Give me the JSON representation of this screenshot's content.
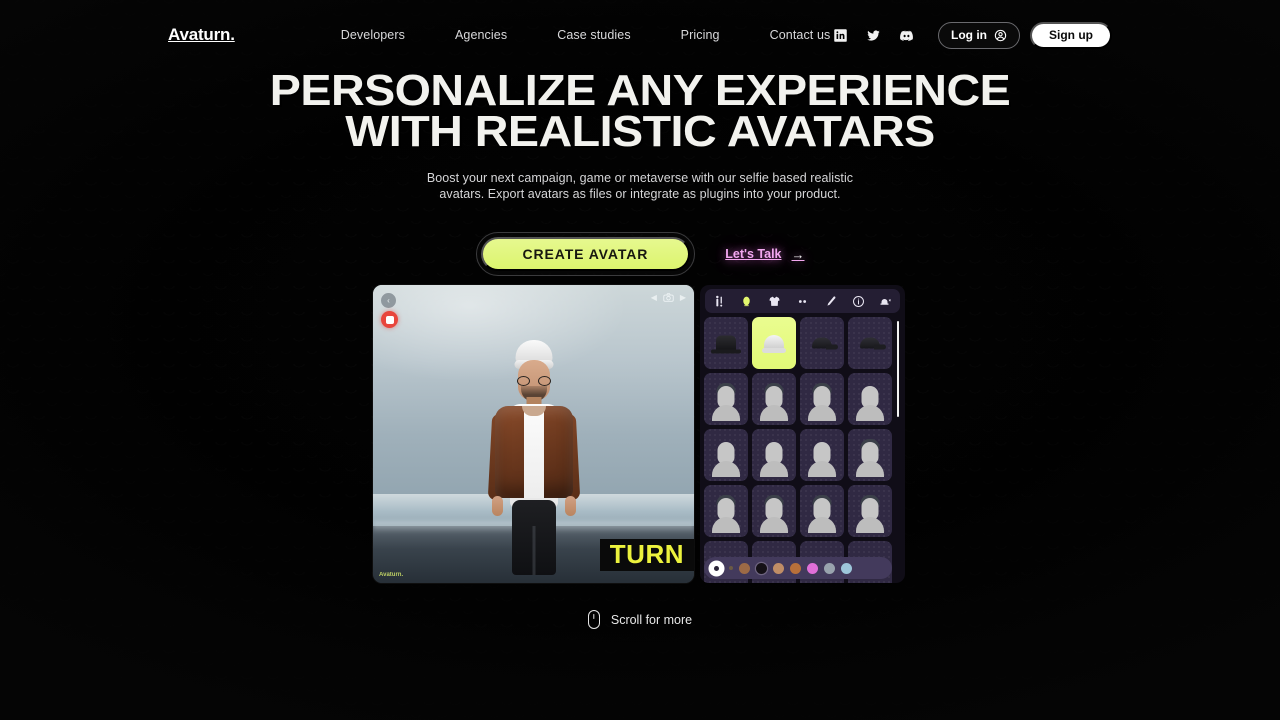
{
  "brand": {
    "name": "Avaturn."
  },
  "nav": {
    "links": [
      {
        "label": "Developers"
      },
      {
        "label": "Agencies"
      },
      {
        "label": "Case studies"
      },
      {
        "label": "Pricing"
      },
      {
        "label": "Contact us"
      }
    ],
    "social": [
      {
        "name": "linkedin-icon"
      },
      {
        "name": "twitter-icon"
      },
      {
        "name": "discord-icon"
      }
    ],
    "login_label": "Log in",
    "signup_label": "Sign up"
  },
  "hero": {
    "headline_line1": "PERSONALIZE ANY EXPERIENCE",
    "headline_line2": "WITH REALISTIC AVATARS",
    "subtitle_line1": "Boost your next campaign, game or metaverse with our selfie based realistic",
    "subtitle_line2": "avatars. Export avatars as files or integrate as plugins into your product.",
    "cta_primary": "CREATE AVATAR",
    "cta_secondary": "Let's Talk",
    "cta_secondary_arrow": "→"
  },
  "app": {
    "viewport": {
      "watermark": "Avaturn.",
      "turn_badge": "TURN",
      "back_glyph": "‹",
      "camera_prev_glyph": "◀",
      "camera_next_glyph": "▶"
    },
    "editor": {
      "toolbar": [
        {
          "name": "body-icon",
          "active": false
        },
        {
          "name": "head-icon",
          "active": true
        },
        {
          "name": "shirt-icon",
          "active": false
        },
        {
          "name": "eyes-icon",
          "active": false
        },
        {
          "name": "brush-icon",
          "active": false
        },
        {
          "name": "info-icon",
          "active": false
        },
        {
          "name": "remove-hat-icon",
          "active": false
        }
      ],
      "grid_items": [
        {
          "type": "hat-top",
          "selected": false
        },
        {
          "type": "hat-beanie",
          "selected": true
        },
        {
          "type": "hat-cap",
          "selected": false
        },
        {
          "type": "hat-cap",
          "selected": false
        },
        {
          "type": "hair-short",
          "selected": false
        },
        {
          "type": "hair-short",
          "selected": false
        },
        {
          "type": "hair-short",
          "selected": false
        },
        {
          "type": "hair-bald",
          "selected": false
        },
        {
          "type": "hair-bald",
          "selected": false
        },
        {
          "type": "hair-bald",
          "selected": false
        },
        {
          "type": "hair-bald",
          "selected": false
        },
        {
          "type": "hair-side",
          "selected": false
        },
        {
          "type": "hair-curly",
          "selected": false
        },
        {
          "type": "hair-short",
          "selected": false
        },
        {
          "type": "hair-long",
          "selected": false
        },
        {
          "type": "hair-short",
          "selected": false
        }
      ],
      "colors": [
        {
          "hex": "#ffffff",
          "selected": true
        },
        {
          "hex": "#6b5a44",
          "tiny": true
        },
        {
          "hex": "#9c6a46"
        },
        {
          "hex": "#141016"
        },
        {
          "hex": "#c08d66"
        },
        {
          "hex": "#b8703a"
        },
        {
          "hex": "#e06fd8"
        },
        {
          "hex": "#99a3ae"
        },
        {
          "hex": "#9dc6da"
        }
      ]
    }
  },
  "footer": {
    "scroll_label": "Scroll for more",
    "mouse_icon": "mouse-icon"
  },
  "colors": {
    "accent_lime": "#e2f977",
    "accent_pink": "#f3a8f0",
    "background": "#050505",
    "panel": "#100d17",
    "tile": "#302943"
  }
}
